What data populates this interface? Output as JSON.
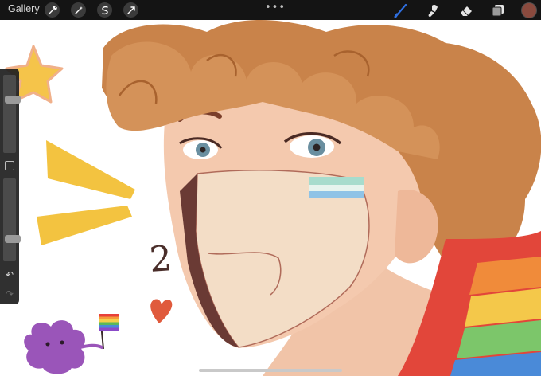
{
  "toolbar": {
    "gallery_label": "Gallery",
    "tools_left": [
      "wrench-icon",
      "magic-wand-icon",
      "selection-icon",
      "transform-icon"
    ],
    "more_dots": "•••",
    "tools_right": [
      "brush-icon",
      "smudge-icon",
      "eraser-icon",
      "layers-icon"
    ],
    "active_color": "#8a4a3e",
    "active_tool_color": "#2f6fe0"
  },
  "sidebar": {
    "brush_size": 0.7,
    "brush_opacity": 0.25,
    "undo_glyph": "↶",
    "redo_glyph": "↷"
  },
  "canvas": {
    "numeral": "2"
  }
}
